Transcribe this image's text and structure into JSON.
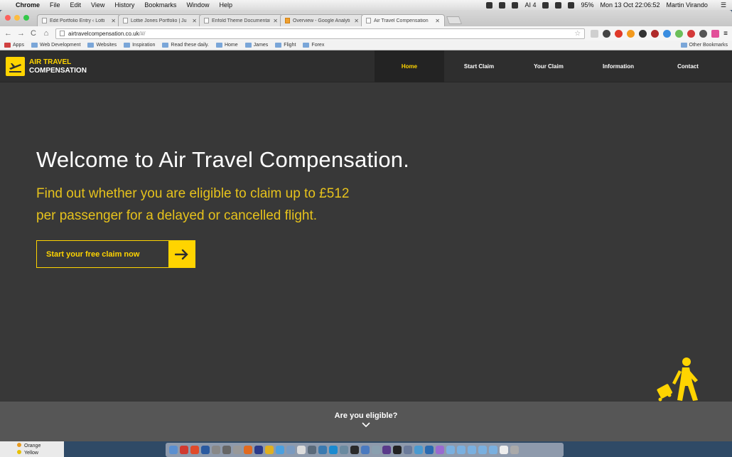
{
  "menubar": {
    "app": "Chrome",
    "items": [
      "File",
      "Edit",
      "View",
      "History",
      "Bookmarks",
      "Window",
      "Help"
    ],
    "status_ai": "4",
    "battery": "95%",
    "clock": "Mon 13 Oct  22:06:52",
    "user": "Martin Virando"
  },
  "tabs": [
    {
      "label": "Edit Portfolio Entry ‹ Lotti"
    },
    {
      "label": "Lottie Jones Portfolio | Ju"
    },
    {
      "label": "Enfold Theme Documentat"
    },
    {
      "label": "Overview - Google Analyti"
    },
    {
      "label": "Air Travel Compensation"
    }
  ],
  "address": {
    "host": "airtravelcompensation.co.uk",
    "path": "/#/"
  },
  "bookmarks": [
    "Apps",
    "Web Development",
    "Websites",
    "Inspiration",
    "Read these daily.",
    "Home",
    "James",
    "Flight",
    "Forex"
  ],
  "bookmarks_other": "Other Bookmarks",
  "site": {
    "logo_line1": "AIR TRAVEL",
    "logo_line2": "COMPENSATION",
    "nav": [
      {
        "label": "Home",
        "active": true
      },
      {
        "label": "Start Claim",
        "active": false
      },
      {
        "label": "Your Claim",
        "active": false
      },
      {
        "label": "Information",
        "active": false
      },
      {
        "label": "Contact",
        "active": false
      }
    ],
    "hero_title": "Welcome to Air Travel Compensation.",
    "hero_sub_line1": "Find out whether you are eligible to claim up to £512",
    "hero_sub_line2": "per passenger for a delayed or cancelled flight.",
    "cta_label": "Start your free claim now",
    "eligible_label": "Are you eligible?",
    "accent": "#ffd400"
  },
  "finder": {
    "items": [
      "Orange",
      "Yellow"
    ]
  }
}
